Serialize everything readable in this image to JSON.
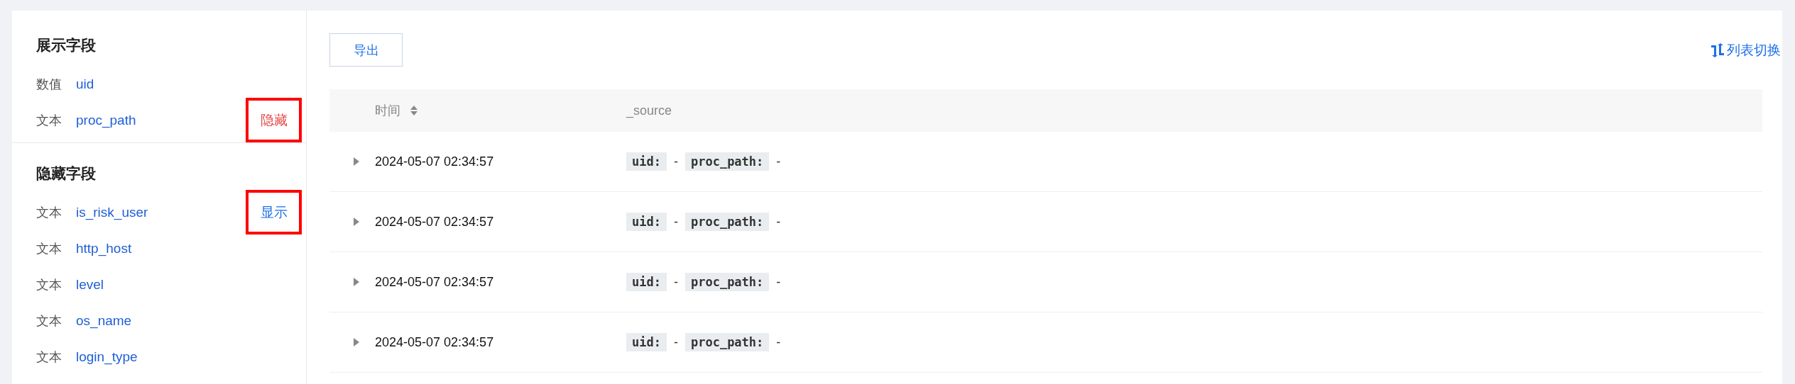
{
  "sidebar": {
    "sections": [
      {
        "title": "展示字段",
        "fields": [
          {
            "type": "数值",
            "name": "uid"
          },
          {
            "type": "文本",
            "name": "proc_path",
            "action": {
              "label": "隐藏",
              "kind": "hide",
              "highlighted": true
            }
          }
        ]
      },
      {
        "title": "隐藏字段",
        "fields": [
          {
            "type": "文本",
            "name": "is_risk_user",
            "action": {
              "label": "显示",
              "kind": "show",
              "highlighted": true
            }
          },
          {
            "type": "文本",
            "name": "http_host"
          },
          {
            "type": "文本",
            "name": "level"
          },
          {
            "type": "文本",
            "name": "os_name"
          },
          {
            "type": "文本",
            "name": "login_type"
          }
        ]
      }
    ]
  },
  "toolbar": {
    "export_button": "导出",
    "view_toggle": "列表切换"
  },
  "table": {
    "columns": [
      {
        "label": "时间",
        "sortable": true
      },
      {
        "label": "_source",
        "sortable": false
      }
    ],
    "rows": [
      {
        "time": "2024-05-07 02:34:57",
        "source": [
          {
            "key": "uid:",
            "value": "-"
          },
          {
            "key": "proc_path:",
            "value": "-"
          }
        ]
      },
      {
        "time": "2024-05-07 02:34:57",
        "source": [
          {
            "key": "uid:",
            "value": "-"
          },
          {
            "key": "proc_path:",
            "value": "-"
          }
        ]
      },
      {
        "time": "2024-05-07 02:34:57",
        "source": [
          {
            "key": "uid:",
            "value": "-"
          },
          {
            "key": "proc_path:",
            "value": "-"
          }
        ]
      },
      {
        "time": "2024-05-07 02:34:57",
        "source": [
          {
            "key": "uid:",
            "value": "-"
          },
          {
            "key": "proc_path:",
            "value": "-"
          }
        ]
      }
    ]
  }
}
